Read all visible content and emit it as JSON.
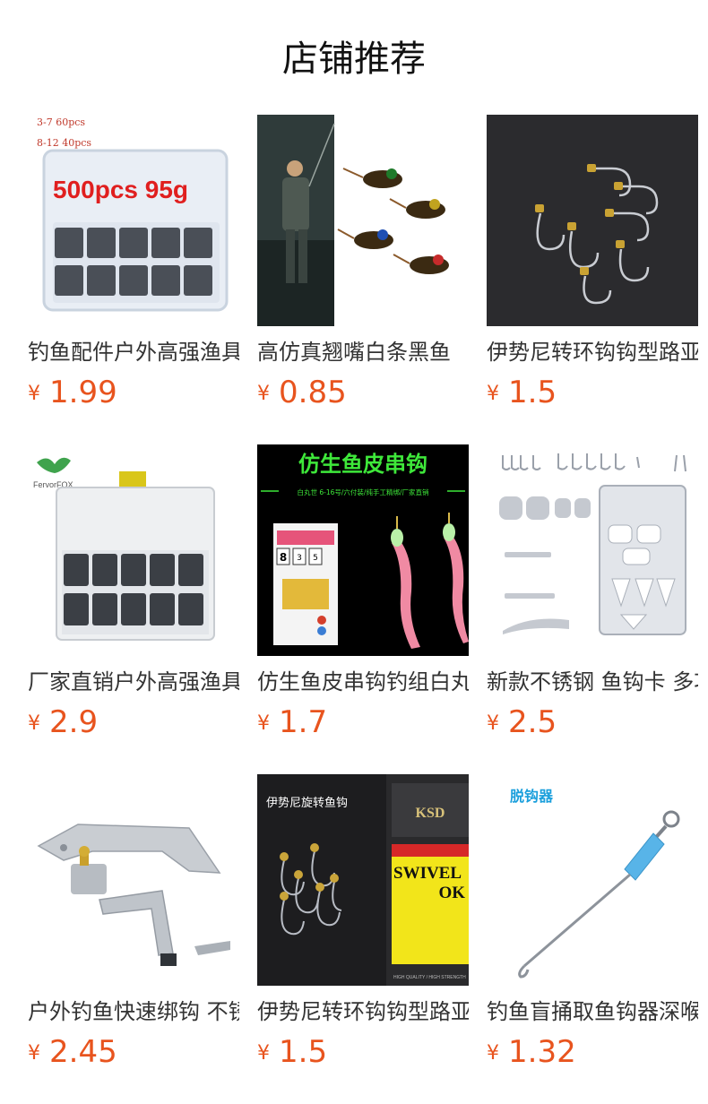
{
  "title": "店铺推荐",
  "currency_symbol": "¥",
  "accent_color": "#e8541e",
  "products": [
    {
      "name": "钓鱼配件户外高强渔具",
      "price": "1.99",
      "image": {
        "caption": "500pcs 95g",
        "small_text": [
          "3-7   60pcs",
          "8-12    40pcs"
        ]
      }
    },
    {
      "name": "高仿真翘嘴白条黑鱼",
      "price": "0.85",
      "image": {}
    },
    {
      "name": "伊势尼转环钩钩型路亚",
      "price": "1.5",
      "image": {}
    },
    {
      "name": "厂家直销户外高强渔具",
      "price": "2.9",
      "image": {
        "brand": "FervorFOX"
      }
    },
    {
      "name": "仿生鱼皮串钩钓组白丸",
      "price": "1.7",
      "image": {
        "headline": "仿生鱼皮串钩",
        "subline": "白丸世 6-16号/六付装/纯手工精绑/厂家直销",
        "badge": "8",
        "pack_small_text": [
          "3",
          "5"
        ]
      }
    },
    {
      "name": "新款不锈钢 鱼钩卡 多功能",
      "price": "2.5",
      "image": {}
    },
    {
      "name": "户外钓鱼快速绑钩 不锈钢",
      "price": "2.45",
      "image": {}
    },
    {
      "name": "伊势尼转环钩钩型路亚",
      "price": "1.5",
      "image": {
        "label": "伊势尼旋转鱼钩",
        "pack_text": "SWIVEL",
        "pack_text2": "OK",
        "pack_logo": "KSD",
        "pack_footer": "HIGH QUALITY / HIGH STRENGTH"
      }
    },
    {
      "name": "钓鱼盲捅取鱼钩器深喉",
      "price": "1.32",
      "image": {
        "label": "脱钩器"
      }
    }
  ]
}
